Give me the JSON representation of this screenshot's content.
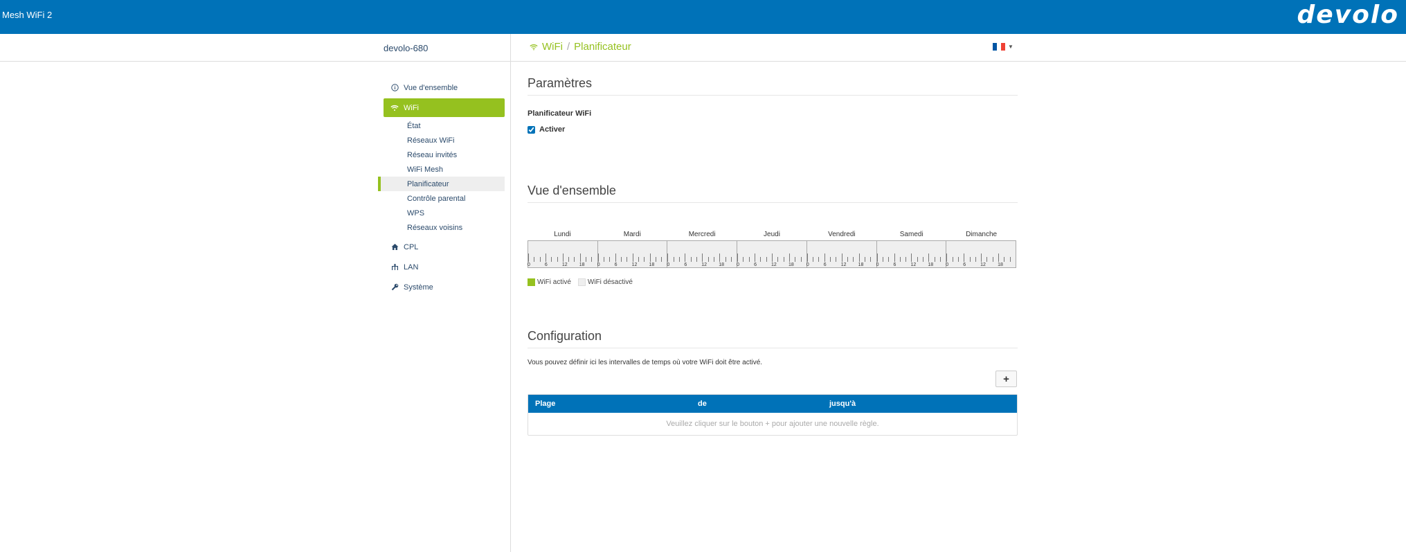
{
  "header": {
    "app_title": "Mesh WiFi 2",
    "brand": "devolo"
  },
  "device_name": "devolo-680",
  "breadcrumb": {
    "parent": "WiFi",
    "separator": "/",
    "current": "Planificateur"
  },
  "language": {
    "selected": "fr"
  },
  "colors": {
    "brand_blue": "#0072b8",
    "accent_green": "#95c11f"
  },
  "sidebar": {
    "items": [
      {
        "label": "Vue d'ensemble",
        "icon": "info-icon"
      },
      {
        "label": "WiFi",
        "icon": "wifi-icon"
      },
      {
        "label": "CPL",
        "icon": "home-icon"
      },
      {
        "label": "LAN",
        "icon": "network-icon"
      },
      {
        "label": "Système",
        "icon": "wrench-icon"
      }
    ],
    "wifi_sub": [
      "État",
      "Réseaux WiFi",
      "Réseau invités",
      "WiFi Mesh",
      "Planificateur",
      "Contrôle parental",
      "WPS",
      "Réseaux voisins"
    ]
  },
  "params": {
    "title": "Paramètres",
    "label": "Planificateur WiFi",
    "checkbox_label": "Activer",
    "checked": true
  },
  "overview": {
    "title": "Vue d'ensemble",
    "days": [
      "Lundi",
      "Mardi",
      "Mercredi",
      "Jeudi",
      "Vendredi",
      "Samedi",
      "Dimanche"
    ],
    "tick_labels": [
      "0",
      "6",
      "12",
      "18"
    ],
    "legend_on": "WiFi activé",
    "legend_off": "WiFi désactivé",
    "color_on": "#95c11f",
    "color_off": "#efefef"
  },
  "config": {
    "title": "Configuration",
    "description": "Vous pouvez définir ici les intervalles de temps où votre WiFi doit être activé.",
    "add_label": "+",
    "columns": [
      "Plage",
      "de",
      "jusqu'à"
    ],
    "empty_message": "Veuillez cliquer sur le bouton + pour ajouter une nouvelle règle."
  }
}
